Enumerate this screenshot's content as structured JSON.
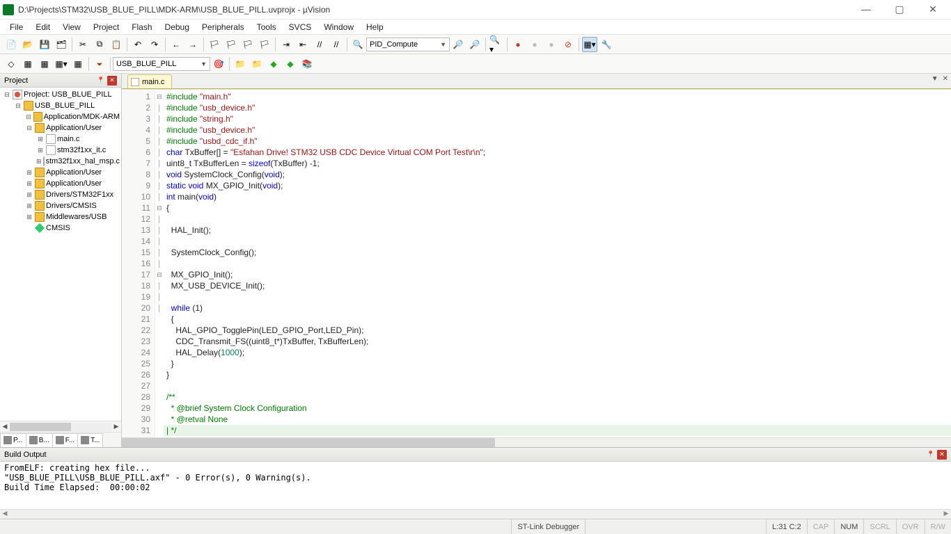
{
  "window": {
    "title": "D:\\Projects\\STM32\\USB_BLUE_PILL\\MDK-ARM\\USB_BLUE_PILL.uvprojx - µVision"
  },
  "menu": [
    "File",
    "Edit",
    "View",
    "Project",
    "Flash",
    "Debug",
    "Peripherals",
    "Tools",
    "SVCS",
    "Window",
    "Help"
  ],
  "toolbar": {
    "search_combo": "PID_Compute",
    "target_combo": "USB_BLUE_PILL"
  },
  "project_panel": {
    "title": "Project",
    "tree": [
      {
        "level": 0,
        "exp": "-",
        "icon": "target",
        "label": "Project: USB_BLUE_PILL"
      },
      {
        "level": 1,
        "exp": "-",
        "icon": "folder",
        "label": "USB_BLUE_PILL"
      },
      {
        "level": 2,
        "exp": "-",
        "icon": "folder",
        "label": "Application/MDK-ARM"
      },
      {
        "level": 2,
        "exp": "-",
        "icon": "folder",
        "label": "Application/User"
      },
      {
        "level": 3,
        "exp": "+",
        "icon": "file",
        "label": "main.c"
      },
      {
        "level": 3,
        "exp": "+",
        "icon": "file",
        "label": "stm32f1xx_it.c"
      },
      {
        "level": 3,
        "exp": "+",
        "icon": "file",
        "label": "stm32f1xx_hal_msp.c"
      },
      {
        "level": 2,
        "exp": "+",
        "icon": "folder",
        "label": "Application/User"
      },
      {
        "level": 2,
        "exp": "+",
        "icon": "folder",
        "label": "Application/User"
      },
      {
        "level": 2,
        "exp": "+",
        "icon": "folder",
        "label": "Drivers/STM32F1xx"
      },
      {
        "level": 2,
        "exp": "+",
        "icon": "folder",
        "label": "Drivers/CMSIS"
      },
      {
        "level": 2,
        "exp": "+",
        "icon": "folder",
        "label": "Middlewares/USB"
      },
      {
        "level": 2,
        "exp": " ",
        "icon": "diamond",
        "label": "CMSIS"
      }
    ],
    "tabs": [
      "P...",
      "B...",
      "F...",
      "T..."
    ]
  },
  "editor": {
    "tab": "main.c",
    "lines": [
      {
        "n": 1,
        "f": "",
        "tok": [
          {
            "c": "kw-pp",
            "t": "#include "
          },
          {
            "c": "kw-str",
            "t": "\"main.h\""
          }
        ]
      },
      {
        "n": 2,
        "f": "",
        "tok": [
          {
            "c": "kw-pp",
            "t": "#include "
          },
          {
            "c": "kw-str",
            "t": "\"usb_device.h\""
          }
        ]
      },
      {
        "n": 3,
        "f": "",
        "tok": [
          {
            "c": "kw-pp",
            "t": "#include "
          },
          {
            "c": "kw-str",
            "t": "\"string.h\""
          }
        ]
      },
      {
        "n": 4,
        "f": "",
        "tok": [
          {
            "c": "kw-pp",
            "t": "#include "
          },
          {
            "c": "kw-str",
            "t": "\"usb_device.h\""
          }
        ]
      },
      {
        "n": 5,
        "f": "",
        "tok": [
          {
            "c": "kw-pp",
            "t": "#include "
          },
          {
            "c": "kw-str",
            "t": "\"usbd_cdc_if.h\""
          }
        ]
      },
      {
        "n": 6,
        "f": "",
        "tok": [
          {
            "c": "kw-blue",
            "t": "char"
          },
          {
            "c": "",
            "t": " TxBuffer[] = "
          },
          {
            "c": "kw-str",
            "t": "\"Esfahan Drive! STM32 USB CDC Device Virtual COM Port Test\\r\\n\""
          },
          {
            "c": "",
            "t": ";"
          }
        ]
      },
      {
        "n": 7,
        "f": "",
        "tok": [
          {
            "c": "",
            "t": "uint8_t TxBufferLen = "
          },
          {
            "c": "kw-blue",
            "t": "sizeof"
          },
          {
            "c": "",
            "t": "(TxBuffer) -1;"
          }
        ]
      },
      {
        "n": 8,
        "f": "",
        "tok": [
          {
            "c": "kw-blue",
            "t": "void"
          },
          {
            "c": "",
            "t": " SystemClock_Config("
          },
          {
            "c": "kw-blue",
            "t": "void"
          },
          {
            "c": "",
            "t": ");"
          }
        ]
      },
      {
        "n": 9,
        "f": "",
        "tok": [
          {
            "c": "kw-blue",
            "t": "static void"
          },
          {
            "c": "",
            "t": " MX_GPIO_Init("
          },
          {
            "c": "kw-blue",
            "t": "void"
          },
          {
            "c": "",
            "t": ");"
          }
        ]
      },
      {
        "n": 10,
        "f": "",
        "tok": [
          {
            "c": "kw-blue",
            "t": "int"
          },
          {
            "c": "",
            "t": " main("
          },
          {
            "c": "kw-blue",
            "t": "void"
          },
          {
            "c": "",
            "t": ")"
          }
        ]
      },
      {
        "n": 11,
        "f": "-",
        "tok": [
          {
            "c": "",
            "t": "{"
          }
        ]
      },
      {
        "n": 12,
        "f": "|",
        "tok": [
          {
            "c": "",
            "t": ""
          }
        ]
      },
      {
        "n": 13,
        "f": "|",
        "tok": [
          {
            "c": "",
            "t": "  HAL_Init();"
          }
        ]
      },
      {
        "n": 14,
        "f": "|",
        "tok": [
          {
            "c": "",
            "t": ""
          }
        ]
      },
      {
        "n": 15,
        "f": "|",
        "tok": [
          {
            "c": "",
            "t": "  SystemClock_Config();"
          }
        ]
      },
      {
        "n": 16,
        "f": "|",
        "tok": [
          {
            "c": "",
            "t": ""
          }
        ]
      },
      {
        "n": 17,
        "f": "|",
        "tok": [
          {
            "c": "",
            "t": "  MX_GPIO_Init();"
          }
        ]
      },
      {
        "n": 18,
        "f": "|",
        "tok": [
          {
            "c": "",
            "t": "  MX_USB_DEVICE_Init();"
          }
        ]
      },
      {
        "n": 19,
        "f": "|",
        "tok": [
          {
            "c": "",
            "t": ""
          }
        ]
      },
      {
        "n": 20,
        "f": "|",
        "tok": [
          {
            "c": "",
            "t": "  "
          },
          {
            "c": "kw-blue",
            "t": "while"
          },
          {
            "c": "",
            "t": " (1)"
          }
        ]
      },
      {
        "n": 21,
        "f": "-",
        "tok": [
          {
            "c": "",
            "t": "  {"
          }
        ]
      },
      {
        "n": 22,
        "f": "|",
        "tok": [
          {
            "c": "",
            "t": "    HAL_GPIO_TogglePin(LED_GPIO_Port,LED_Pin);"
          }
        ]
      },
      {
        "n": 23,
        "f": "|",
        "tok": [
          {
            "c": "",
            "t": "    CDC_Transmit_FS((uint8_t*)TxBuffer, TxBufferLen);"
          }
        ]
      },
      {
        "n": 24,
        "f": "|",
        "tok": [
          {
            "c": "",
            "t": "    HAL_Delay("
          },
          {
            "c": "kw-num",
            "t": "1000"
          },
          {
            "c": "",
            "t": ");"
          }
        ]
      },
      {
        "n": 25,
        "f": "|",
        "tok": [
          {
            "c": "",
            "t": "  }"
          }
        ]
      },
      {
        "n": 26,
        "f": "|",
        "tok": [
          {
            "c": "",
            "t": "}"
          }
        ]
      },
      {
        "n": 27,
        "f": "",
        "tok": [
          {
            "c": "",
            "t": ""
          }
        ]
      },
      {
        "n": 28,
        "f": "-",
        "tok": [
          {
            "c": "kw-cmt",
            "t": "/**"
          }
        ]
      },
      {
        "n": 29,
        "f": "|",
        "tok": [
          {
            "c": "kw-cmt",
            "t": "  * @brief System Clock Configuration"
          }
        ]
      },
      {
        "n": 30,
        "f": "|",
        "tok": [
          {
            "c": "kw-cmt",
            "t": "  * @retval None"
          }
        ]
      },
      {
        "n": 31,
        "f": "|",
        "tok": [
          {
            "c": "kw-cmt",
            "t": "| */"
          }
        ],
        "hl": true
      }
    ]
  },
  "build": {
    "title": "Build Output",
    "lines": [
      "FromELF: creating hex file...",
      "\"USB_BLUE_PILL\\USB_BLUE_PILL.axf\" - 0 Error(s), 0 Warning(s).",
      "Build Time Elapsed:  00:00:02"
    ]
  },
  "status": {
    "debugger": "ST-Link Debugger",
    "cursor": "L:31 C:2",
    "caps": "CAP",
    "num": "NUM",
    "scrl": "SCRL",
    "ovr": "OVR",
    "rw": "R/W"
  }
}
